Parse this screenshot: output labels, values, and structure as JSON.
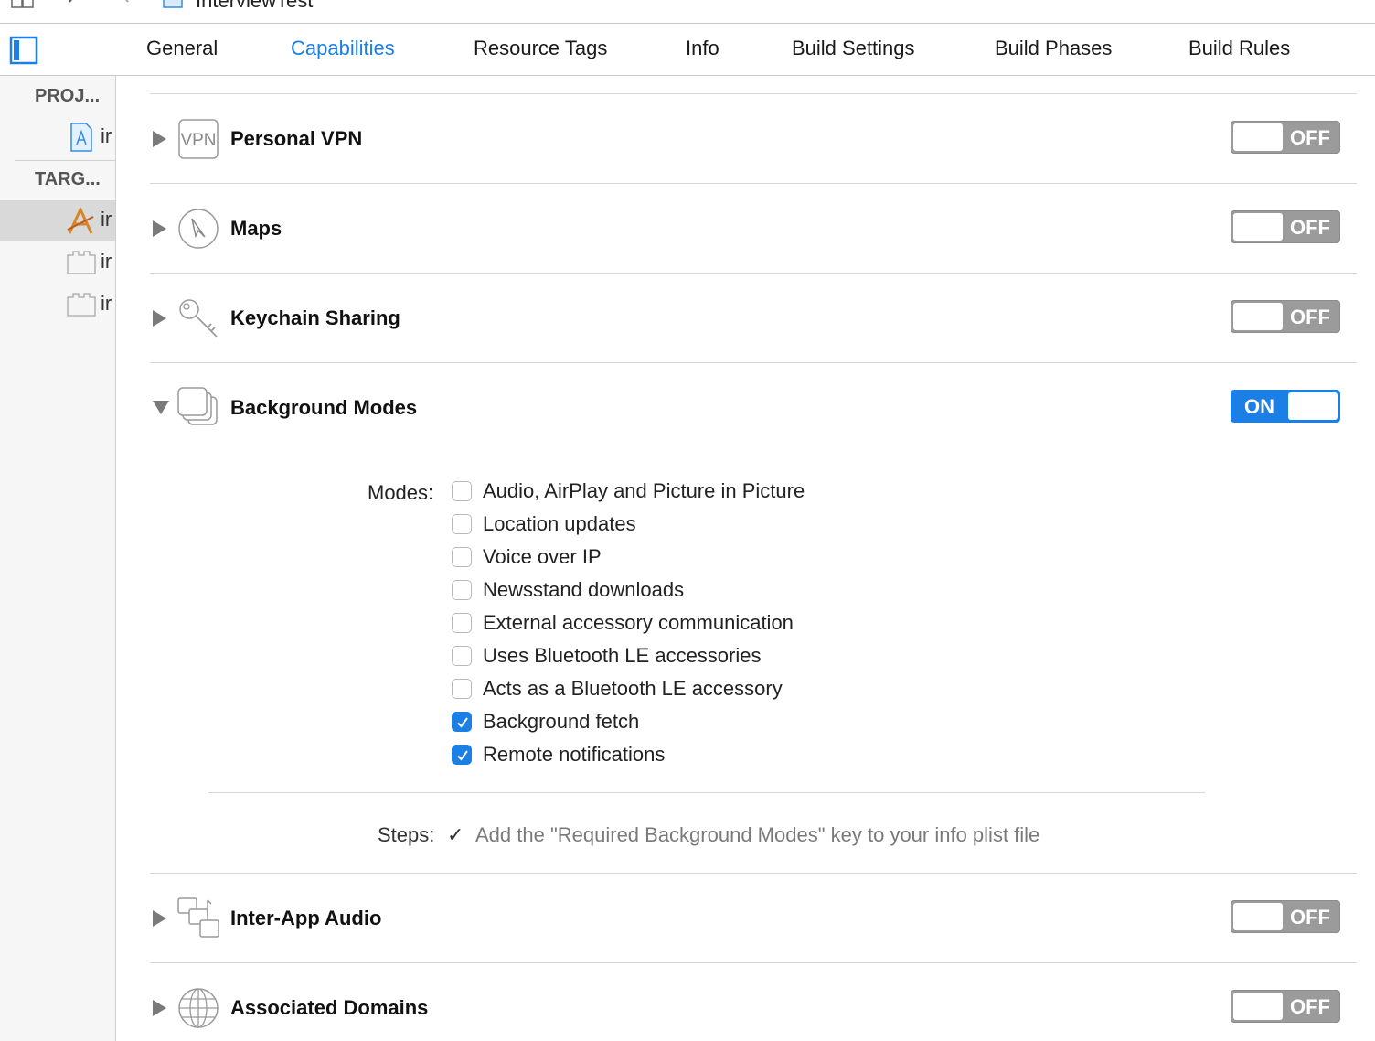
{
  "breadcrumb": {
    "project": "InterviewTest"
  },
  "tabs": [
    {
      "label": "General"
    },
    {
      "label": "Capabilities"
    },
    {
      "label": "Resource Tags"
    },
    {
      "label": "Info"
    },
    {
      "label": "Build Settings"
    },
    {
      "label": "Build Phases"
    },
    {
      "label": "Build Rules"
    }
  ],
  "active_tab": "Capabilities",
  "sidebar": {
    "project_header": "PROJ...",
    "targets_header": "TARG...",
    "project_items": [
      {
        "label": "ir",
        "icon": "xcodeproj-icon"
      }
    ],
    "target_items": [
      {
        "label": "ir",
        "icon": "app-target-icon"
      },
      {
        "label": "ir",
        "icon": "test-bundle-icon"
      },
      {
        "label": "ir",
        "icon": "ui-test-bundle-icon"
      }
    ]
  },
  "capabilities": {
    "personal_vpn": {
      "title": "Personal VPN",
      "icon": "vpn-icon",
      "icon_text": "VPN",
      "state": "OFF"
    },
    "maps": {
      "title": "Maps",
      "icon": "compass-icon",
      "state": "OFF"
    },
    "keychain": {
      "title": "Keychain Sharing",
      "icon": "key-icon",
      "state": "OFF"
    },
    "background_modes": {
      "title": "Background Modes",
      "icon": "stacked-windows-icon",
      "state": "ON"
    },
    "inter_app_audio": {
      "title": "Inter-App Audio",
      "icon": "inter-app-audio-icon",
      "state": "OFF"
    },
    "associated_domains": {
      "title": "Associated Domains",
      "icon": "globe-icon",
      "state": "OFF"
    }
  },
  "background_modes": {
    "modes_label": "Modes:",
    "modes": [
      {
        "label": "Audio, AirPlay and Picture in Picture",
        "checked": false
      },
      {
        "label": "Location updates",
        "checked": false
      },
      {
        "label": "Voice over IP",
        "checked": false
      },
      {
        "label": "Newsstand downloads",
        "checked": false
      },
      {
        "label": "External accessory communication",
        "checked": false
      },
      {
        "label": "Uses Bluetooth LE accessories",
        "checked": false
      },
      {
        "label": "Acts as a Bluetooth LE accessory",
        "checked": false
      },
      {
        "label": "Background fetch",
        "checked": true
      },
      {
        "label": "Remote notifications",
        "checked": true
      }
    ],
    "steps_label": "Steps:",
    "steps_check": "✓",
    "steps_text": "Add the \"Required Background Modes\" key to your info plist file"
  },
  "colors": {
    "accent": "#1b7fe6",
    "toggle_off": "#9b9b9b",
    "separator": "#d6d6d6"
  }
}
